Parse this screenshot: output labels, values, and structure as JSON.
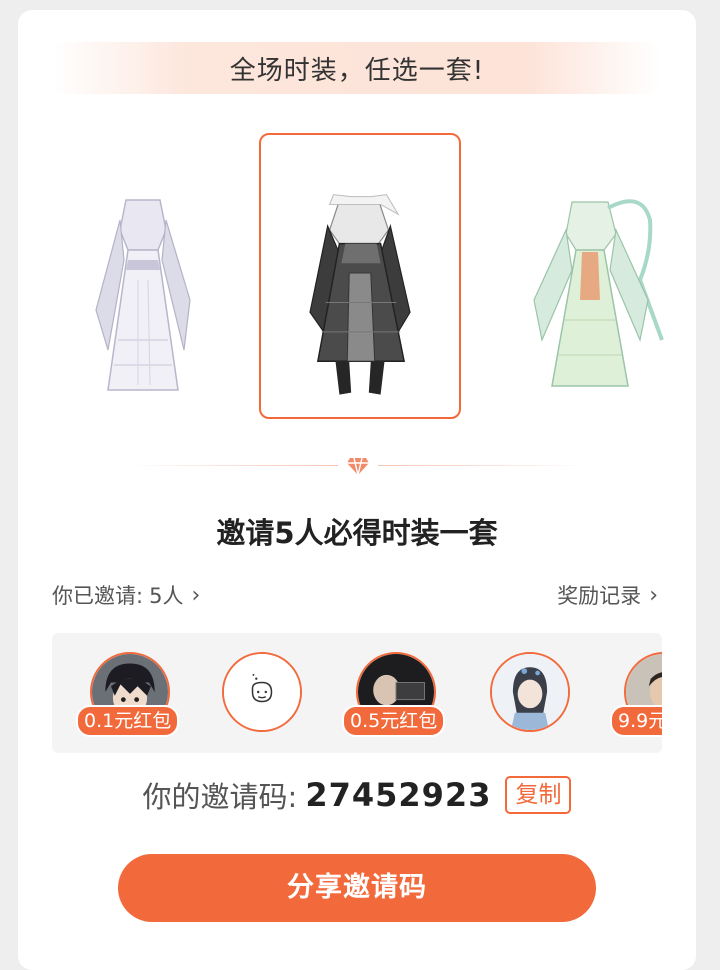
{
  "banner": {
    "text": "全场时装，任选一套!"
  },
  "outfits": [
    {
      "name": "white-hanfu-dress"
    },
    {
      "name": "black-armor-robe",
      "selected": true
    },
    {
      "name": "green-flowing-dress"
    }
  ],
  "title": "邀请5人必得时装一套",
  "invited": {
    "label": "你已邀请:",
    "count": "5人",
    "chevron": "›"
  },
  "records": {
    "label": "奖励记录",
    "chevron": "›"
  },
  "invitees": [
    {
      "avatar": "anime-boy-avatar",
      "badge": "0.1元红包"
    },
    {
      "avatar": "default-face-avatar",
      "badge": ""
    },
    {
      "avatar": "dark-photo-avatar",
      "badge": "0.5元红包"
    },
    {
      "avatar": "anime-girl-avatar",
      "badge": ""
    },
    {
      "avatar": "man-portrait-avatar",
      "badge": "9.9元红包"
    }
  ],
  "invite_code": {
    "label": "你的邀请码:",
    "value": "27452923",
    "copy_label": "复制"
  },
  "share_button": {
    "label": "分享邀请码"
  },
  "colors": {
    "accent": "#f26a3c",
    "banner_bg": "#fde3d8",
    "panel_bg": "#f4f4f4"
  }
}
